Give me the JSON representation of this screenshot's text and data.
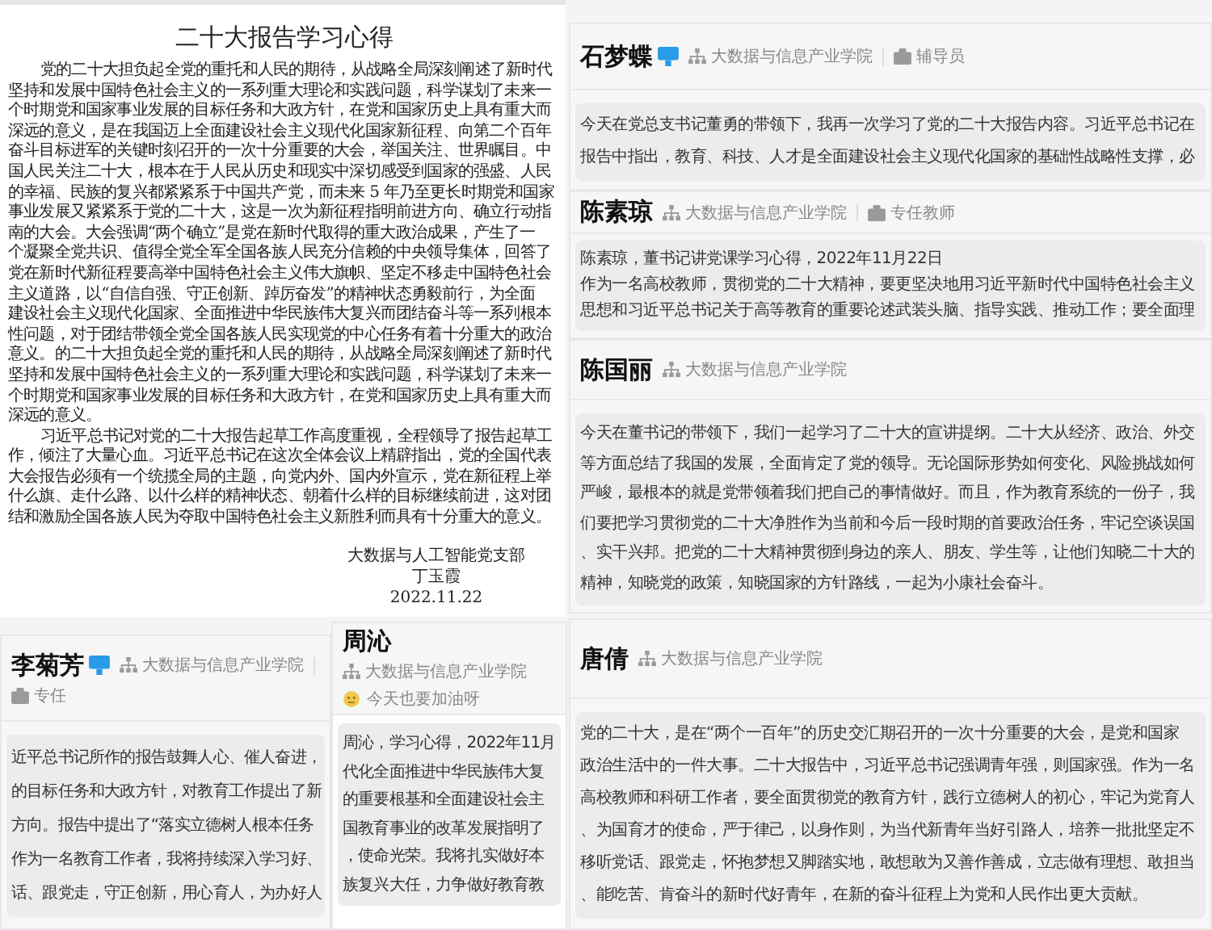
{
  "document": {
    "title": "二十大报告学习心得",
    "paragraphs": [
      [
        "党的二十大担负起全党的重托和人民的期待，从战略全局深刻阐述了新时代",
        "坚持和发展中国特色社会主义的一系列重大理论和实践问题，科学谋划了未来一",
        "个时期党和国家事业发展的目标任务和大政方针，在党和国家历史上具有重大而",
        "深远的意义，是在我国迈上全面建设社会主义现代化国家新征程、向第二个百年",
        "奋斗目标进军的关键时刻召开的一次十分重要的大会，举国关注、世界瞩目。中",
        "国人民关注二十大，根本在于人民从历史和现实中深切感受到国家的强盛、人民",
        "的幸福、民族的复兴都紧紧系于中国共产党，而未来 5 年乃至更长时期党和国家",
        "事业发展又紧紧系于党的二十大，这是一次为新征程指明前进方向、确立行动指",
        "南的大会。大会强调“两个确立”是党在新时代取得的重大政治成果，产生了一",
        "个凝聚全党共识、值得全党全军全国各族人民充分信赖的中央领导集体，回答了",
        "党在新时代新征程要高举中国特色社会主义伟大旗帜、坚定不移走中国特色社会",
        "主义道路，以“自信自强、守正创新、踔厉奋发”的精神状态勇毅前行，为全面",
        "建设社会主义现代化国家、全面推进中华民族伟大复兴而团结奋斗等一系列根本",
        "性问题，对于团结带领全党全国各族人民实现党的中心任务有着十分重大的政治",
        "意义。的二十大担负起全党的重托和人民的期待，从战略全局深刻阐述了新时代",
        "坚持和发展中国特色社会主义的一系列重大理论和实践问题，科学谋划了未来一",
        "个时期党和国家事业发展的目标任务和大政方针，在党和国家历史上具有重大而",
        "深远的意义。"
      ],
      [
        "习近平总书记对党的二十大报告起草工作高度重视，全程领导了报告起草工",
        "作，倾注了大量心血。习近平总书记在这次全体会议上精辟指出，党的全国代表",
        "大会报告必须有一个统揽全局的主题，向党内外、国内外宣示，党在新征程上举",
        "什么旗、走什么路、以什么样的精神状态、朝着什么样的目标继续前进，这对团",
        "结和激励全国各族人民为夺取中国特色社会主义新胜利而具有十分重大的意义。"
      ]
    ],
    "signature": [
      "大数据与人工智能党支部",
      "丁玉霞",
      "2022.11.22"
    ]
  },
  "posts": [
    {
      "name": "石梦蝶",
      "badge": true,
      "department": "大数据与信息产业学院",
      "role": "辅导员",
      "lines": [
        "今天在党总支书记董勇的带领下，我再一次学习了党的二十大报告内容。习近平总书记在",
        "报告中指出，教育、科技、人才是全面建设社会主义现代化国家的基础性战略性支撑，必"
      ]
    },
    {
      "name": "陈素琼",
      "badge": false,
      "department": "大数据与信息产业学院",
      "role": "专任教师",
      "lines": [
        "陈素琼，董书记讲党课学习心得，2022年11月22日",
        "作为一名高校教师，贯彻党的二十大精神，要更坚决地用习近平新时代中国特色社会主义",
        "思想和习近平总书记关于高等教育的重要论述武装头脑、指导实践、推动工作；要全面理"
      ]
    },
    {
      "name": "陈国丽",
      "badge": false,
      "department": "大数据与信息产业学院",
      "lines": [
        "今天在董书记的带领下，我们一起学习了二十大的宣讲提纲。二十大从经济、政治、外交",
        "等方面总结了我国的发展，全面肯定了党的领导。无论国际形势如何变化、风险挑战如何",
        "严峻，最根本的就是党带领着我们把自己的事情做好。而且，作为教育系统的一份子，我",
        "们要把学习贯彻党的二十大净胜作为当前和今后一段时期的首要政治任务，牢记空谈误国",
        "、实干兴邦。把党的二十大精神贯彻到身边的亲人、朋友、学生等，让他们知晓二十大的",
        "精神，知晓党的政策，知晓国家的方针路线，一起为小康社会奋斗。"
      ]
    },
    {
      "name": "李菊芳",
      "badge": true,
      "department": "大数据与信息产业学院",
      "role": "专任",
      "lines": [
        "近平总书记所作的报告鼓舞人心、催人奋进，",
        "的目标任务和大政方针，对教育工作提出了新",
        "方向。报告中提出了“落实立德树人根本任务",
        "作为一名教育工作者，我将持续深入学习好、",
        "话、跟党走，守正创新，用心育人，为办好人"
      ]
    },
    {
      "name": "周沁",
      "badge": false,
      "department": "大数据与信息产业学院",
      "status": "今天也要加油呀",
      "lines": [
        "周沁，学习心得，2022年11月",
        "代化全面推进中华民族伟大复",
        "的重要根基和全面建设社会主",
        "国教育事业的改革发展指明了",
        "，使命光荣。我将扎实做好本",
        "族复兴大任，力争做好教育教"
      ]
    },
    {
      "name": "唐倩",
      "badge": false,
      "department": "大数据与信息产业学院",
      "lines": [
        "党的二十大，是在“两个一百年”的历史交汇期召开的一次十分重要的大会，是党和国家",
        "政治生活中的一件大事。二十大报告中，习近平总书记强调青年强，则国家强。作为一名",
        "高校教师和科研工作者，要全面贯彻党的教育方针，践行立德树人的初心，牢记为党育人",
        "、为国育才的使命，严于律己，以身作则，为当代新青年当好引路人，培养一批批坚定不",
        "移听党话、跟党走，怀抱梦想又脚踏实地，敢想敢为又善作善成，立志做有理想、敢担当",
        "、能吃苦、肯奋斗的新时代好青年，在新的奋斗征程上为党和人民作出更大贡献。"
      ]
    }
  ]
}
